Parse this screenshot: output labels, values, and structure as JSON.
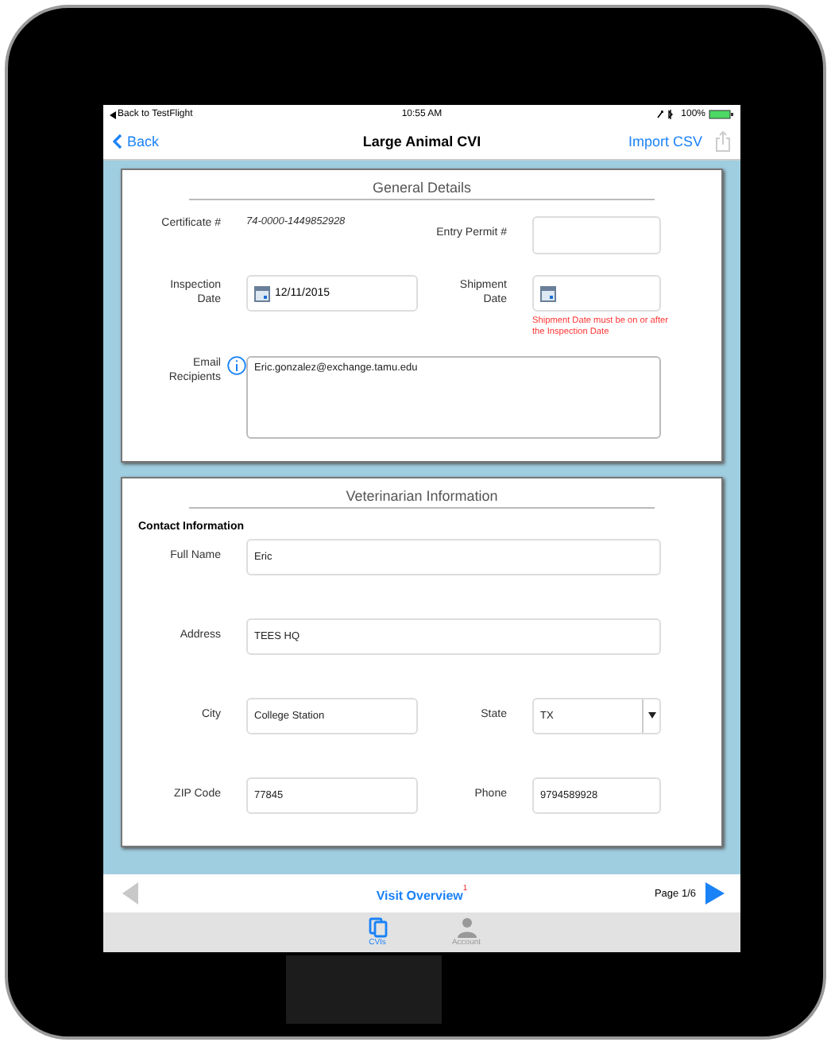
{
  "status_bar": {
    "back_app": "Back to TestFlight",
    "time": "10:55 AM",
    "battery": "100%"
  },
  "nav_bar": {
    "back": "Back",
    "title": "Large Animal CVI",
    "action": "Import CSV"
  },
  "general_details": {
    "title": "General Details",
    "certificate": {
      "label": "Certificate #",
      "value": "74-0000-1449852928"
    },
    "entry_permit": {
      "label": "Entry Permit #"
    },
    "inspection_date": {
      "label": "Inspection Date",
      "value": "12/11/2015"
    },
    "shipment_date": {
      "label": "Shipment Date",
      "error": "Shipment Date must be on or after the Inspection Date"
    },
    "email_recipients": {
      "label": "Email Recipients",
      "value": "Eric.gonzalez@exchange.tamu.edu"
    }
  },
  "veterinarian_information": {
    "title": "Veterinarian Information",
    "subtitle": "Contact Information",
    "rows": [
      {
        "fields": [
          {
            "kind": "text",
            "label": "Full Name",
            "value": "Eric"
          }
        ]
      },
      {
        "fields": [
          {
            "kind": "text",
            "label": "Address",
            "value": "TEES HQ"
          }
        ]
      },
      {
        "fields": [
          {
            "kind": "text",
            "label": "City",
            "value": "College Station"
          },
          {
            "kind": "select",
            "label": "State",
            "value": "TX"
          }
        ]
      },
      {
        "fields": [
          {
            "kind": "text",
            "label": "ZIP Code",
            "value": "77845"
          },
          {
            "kind": "text",
            "label": "Phone",
            "value": "9794589928"
          }
        ]
      }
    ]
  },
  "bottom_toolbar": {
    "link": "Visit Overview",
    "badge": "1",
    "page": "Page 1/6"
  },
  "tab_bar": [
    {
      "label": "CVIs",
      "selected": true
    },
    {
      "label": "Account",
      "selected": false
    }
  ]
}
